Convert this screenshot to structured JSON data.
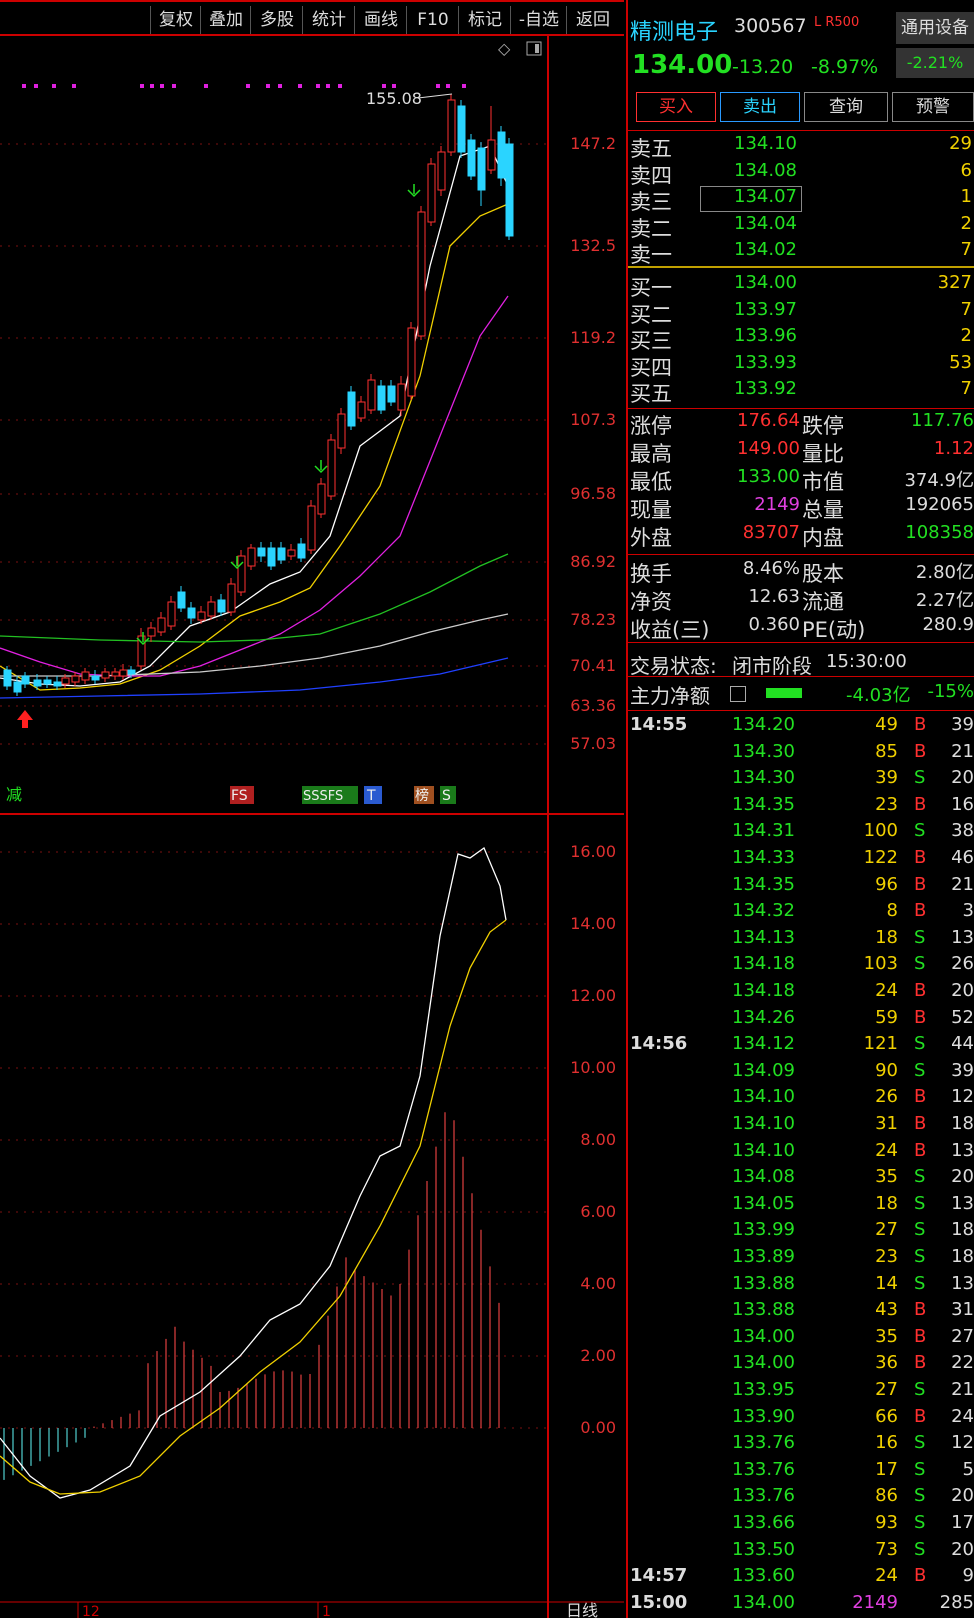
{
  "toolbar": {
    "items": [
      "复权",
      "叠加",
      "多股",
      "统计",
      "画线",
      "F10",
      "标记",
      "-自选",
      "返回"
    ]
  },
  "chart": {
    "price_labels": [
      "147.2",
      "132.5",
      "119.2",
      "107.3",
      "96.58",
      "86.92",
      "78.23",
      "70.41",
      "63.36",
      "57.03"
    ],
    "high_label": "155.08",
    "macd_labels": [
      "16.00",
      "14.00",
      "12.00",
      "10.00",
      "8.00",
      "6.00",
      "4.00",
      "2.00",
      "0.00"
    ],
    "signals": {
      "jian": "减",
      "fs": "FS",
      "sssfs": "SSSFS",
      "t": "T",
      "bang": "榜",
      "s": "S"
    },
    "bottom_labels": {
      "m12": "12",
      "m1": "1",
      "period": "日线"
    }
  },
  "colors": {
    "up": "#ff3030",
    "down": "#22e022",
    "yellow": "#f0d000",
    "cyan": "#2ad4ff"
  },
  "quote": {
    "name": "精测电子",
    "code": "300567",
    "lr": "L R500",
    "device": "通用设备",
    "price": "134.00",
    "change": "-13.20",
    "change_pct": "-8.97%",
    "sector_pct": "-2.21%",
    "buy": "买入",
    "sell": "卖出",
    "query": "查询",
    "alert": "预警"
  },
  "asks": [
    {
      "label": "卖五",
      "price": "134.10",
      "vol": "29"
    },
    {
      "label": "卖四",
      "price": "134.08",
      "vol": "6"
    },
    {
      "label": "卖三",
      "price": "134.07",
      "vol": "1"
    },
    {
      "label": "卖二",
      "price": "134.04",
      "vol": "2"
    },
    {
      "label": "卖一",
      "price": "134.02",
      "vol": "7"
    }
  ],
  "bids": [
    {
      "label": "买一",
      "price": "134.00",
      "vol": "327"
    },
    {
      "label": "买二",
      "price": "133.97",
      "vol": "7"
    },
    {
      "label": "买三",
      "price": "133.96",
      "vol": "2"
    },
    {
      "label": "买四",
      "price": "133.93",
      "vol": "53"
    },
    {
      "label": "买五",
      "price": "133.92",
      "vol": "7"
    }
  ],
  "stats": [
    {
      "l1": "涨停",
      "v1": "176.64",
      "c1": "#ff3030",
      "l2": "跌停",
      "v2": "117.76",
      "c2": "#22e022"
    },
    {
      "l1": "最高",
      "v1": "149.00",
      "c1": "#ff3030",
      "l2": "量比",
      "v2": "1.12",
      "c2": "#ff3030"
    },
    {
      "l1": "最低",
      "v1": "133.00",
      "c1": "#22e022",
      "l2": "市值",
      "v2": "374.9亿",
      "c2": "#ddd"
    },
    {
      "l1": "现量",
      "v1": "2149",
      "c1": "#e040e0",
      "l2": "总量",
      "v2": "192065",
      "c2": "#ddd"
    },
    {
      "l1": "外盘",
      "v1": "83707",
      "c1": "#ff3030",
      "l2": "内盘",
      "v2": "108358",
      "c2": "#22e022"
    }
  ],
  "stats2": [
    {
      "l1": "换手",
      "v1": "8.46%",
      "l2": "股本",
      "v2": "2.80亿"
    },
    {
      "l1": "净资",
      "v1": "12.63",
      "l2": "流通",
      "v2": "2.27亿"
    },
    {
      "l1": "收益(三)",
      "v1": "0.360",
      "l2": "PE(动)",
      "v2": "280.9"
    }
  ],
  "status": {
    "label": "交易状态:",
    "phase": "闭市阶段",
    "time": "15:30:00"
  },
  "flow": {
    "label": "主力净额",
    "value": "-4.03亿",
    "pct": "-15%"
  },
  "ticks": [
    {
      "t": "14:55",
      "p": "134.20",
      "v": "49",
      "bs": "B",
      "n": "39"
    },
    {
      "t": "",
      "p": "134.30",
      "v": "85",
      "bs": "B",
      "n": "21"
    },
    {
      "t": "",
      "p": "134.30",
      "v": "39",
      "bs": "S",
      "n": "20"
    },
    {
      "t": "",
      "p": "134.35",
      "v": "23",
      "bs": "B",
      "n": "16"
    },
    {
      "t": "",
      "p": "134.31",
      "v": "100",
      "bs": "S",
      "n": "38"
    },
    {
      "t": "",
      "p": "134.33",
      "v": "122",
      "bs": "B",
      "n": "46"
    },
    {
      "t": "",
      "p": "134.35",
      "v": "96",
      "bs": "B",
      "n": "21"
    },
    {
      "t": "",
      "p": "134.32",
      "v": "8",
      "bs": "B",
      "n": "3"
    },
    {
      "t": "",
      "p": "134.13",
      "v": "18",
      "bs": "S",
      "n": "13"
    },
    {
      "t": "",
      "p": "134.18",
      "v": "103",
      "bs": "S",
      "n": "26"
    },
    {
      "t": "",
      "p": "134.18",
      "v": "24",
      "bs": "B",
      "n": "20"
    },
    {
      "t": "",
      "p": "134.26",
      "v": "59",
      "bs": "B",
      "n": "52"
    },
    {
      "t": "14:56",
      "p": "134.12",
      "v": "121",
      "bs": "S",
      "n": "44"
    },
    {
      "t": "",
      "p": "134.09",
      "v": "90",
      "bs": "S",
      "n": "39"
    },
    {
      "t": "",
      "p": "134.10",
      "v": "26",
      "bs": "B",
      "n": "12"
    },
    {
      "t": "",
      "p": "134.10",
      "v": "31",
      "bs": "B",
      "n": "18"
    },
    {
      "t": "",
      "p": "134.10",
      "v": "24",
      "bs": "B",
      "n": "13"
    },
    {
      "t": "",
      "p": "134.08",
      "v": "35",
      "bs": "S",
      "n": "20"
    },
    {
      "t": "",
      "p": "134.05",
      "v": "18",
      "bs": "S",
      "n": "13"
    },
    {
      "t": "",
      "p": "133.99",
      "v": "27",
      "bs": "S",
      "n": "18"
    },
    {
      "t": "",
      "p": "133.89",
      "v": "23",
      "bs": "S",
      "n": "18"
    },
    {
      "t": "",
      "p": "133.88",
      "v": "14",
      "bs": "S",
      "n": "13"
    },
    {
      "t": "",
      "p": "133.88",
      "v": "43",
      "bs": "B",
      "n": "31"
    },
    {
      "t": "",
      "p": "134.00",
      "v": "35",
      "bs": "B",
      "n": "27"
    },
    {
      "t": "",
      "p": "134.00",
      "v": "36",
      "bs": "B",
      "n": "22"
    },
    {
      "t": "",
      "p": "133.95",
      "v": "27",
      "bs": "S",
      "n": "21"
    },
    {
      "t": "",
      "p": "133.90",
      "v": "66",
      "bs": "B",
      "n": "24"
    },
    {
      "t": "",
      "p": "133.76",
      "v": "16",
      "bs": "S",
      "n": "12"
    },
    {
      "t": "",
      "p": "133.76",
      "v": "17",
      "bs": "S",
      "n": "5"
    },
    {
      "t": "",
      "p": "133.76",
      "v": "86",
      "bs": "S",
      "n": "20"
    },
    {
      "t": "",
      "p": "133.66",
      "v": "93",
      "bs": "S",
      "n": "17"
    },
    {
      "t": "",
      "p": "133.50",
      "v": "73",
      "bs": "S",
      "n": "20"
    },
    {
      "t": "14:57",
      "p": "133.60",
      "v": "24",
      "bs": "B",
      "n": "9"
    },
    {
      "t": "15:00",
      "p": "134.00",
      "v": "2149",
      "bs": "",
      "n": "285"
    }
  ]
}
